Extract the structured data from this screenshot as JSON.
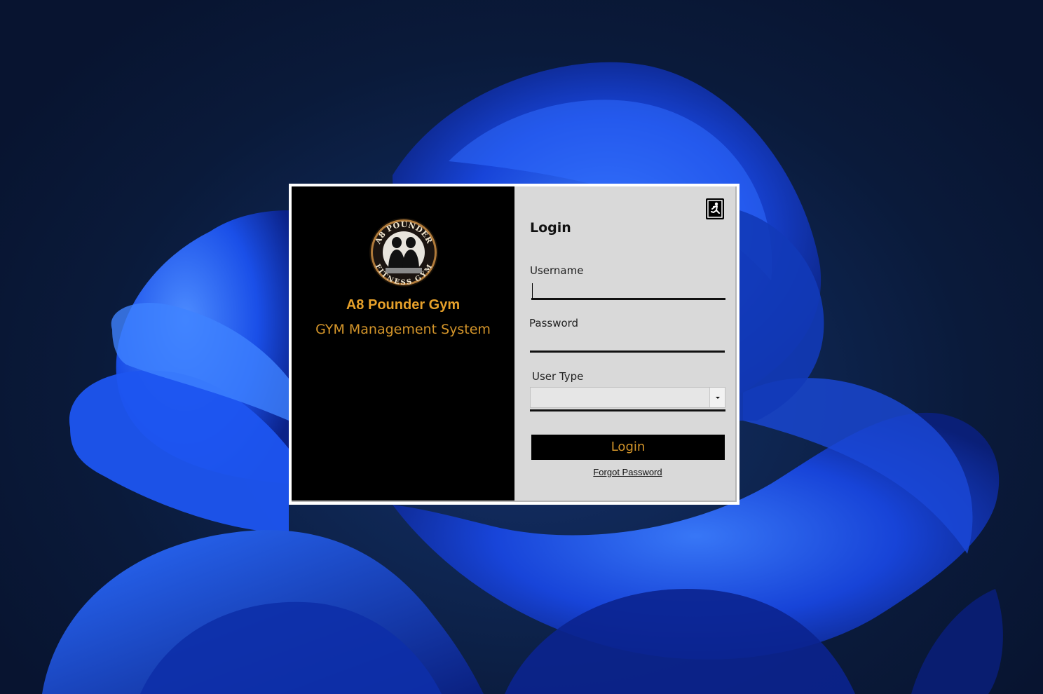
{
  "window": {
    "brand_name": "A8 Pounder Gym",
    "brand_subtitle": "GYM Management System",
    "logo_text_top": "A8 POUNDER",
    "logo_text_bottom": "FITNESS GYM"
  },
  "login": {
    "title": "Login",
    "username_label": "Username",
    "username_value": "",
    "password_label": "Password",
    "password_value": "",
    "user_type_label": "User Type",
    "user_type_value": "",
    "login_button": "Login",
    "forgot_password": "Forgot Password",
    "exit_icon": "running-person-exit-icon"
  },
  "colors": {
    "accent_gold": "#d4952a",
    "brand_gold": "#e6a02a",
    "left_panel_bg": "#000000",
    "right_panel_bg": "#d9d9d9"
  }
}
